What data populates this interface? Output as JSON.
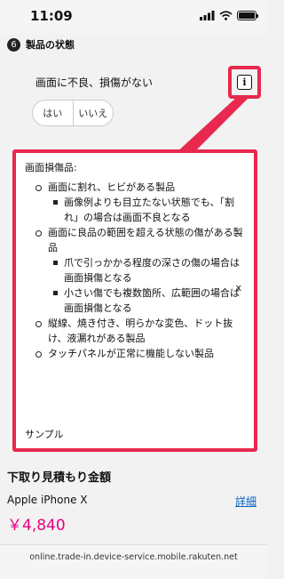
{
  "status_bar": {
    "time": "11:09"
  },
  "section": {
    "number": "6",
    "title": "製品の状態"
  },
  "question": {
    "text": "画面に不良、損傷がない",
    "options": [
      "はい",
      "いいえ"
    ]
  },
  "info_button": {
    "label": "i"
  },
  "tooltip": {
    "title": "画面損傷品:",
    "items": [
      {
        "text": "画面に割れ、ヒビがある製品",
        "sub": [
          "画像例よりも目立たない状態でも、「割れ」の場合は画面不良となる"
        ]
      },
      {
        "text": "画面に良品の範囲を超える状態の傷がある製品",
        "sub": [
          "爪で引っかかる程度の深さの傷の場合は画面損傷となる",
          "小さい傷でも複数箇所、広範囲の場合は画面損傷となる"
        ]
      },
      {
        "text": "縦線、焼き付き、明らかな変色、ドット抜け、液漏れがある製品",
        "sub": []
      },
      {
        "text": "タッチパネルが正常に機能しない製品",
        "sub": []
      }
    ],
    "close_label": "x",
    "sample_label": "サンプル"
  },
  "estimate": {
    "title": "下取り見積もり金額",
    "device": "Apple iPhone X",
    "price": "￥4,840",
    "detail_link": "詳細"
  },
  "browser": {
    "url": "online.trade-in.device-service.mobile.rakuten.net"
  },
  "colors": {
    "highlight": "#e8284e",
    "price": "#e6007e",
    "link": "#0a66c2"
  }
}
